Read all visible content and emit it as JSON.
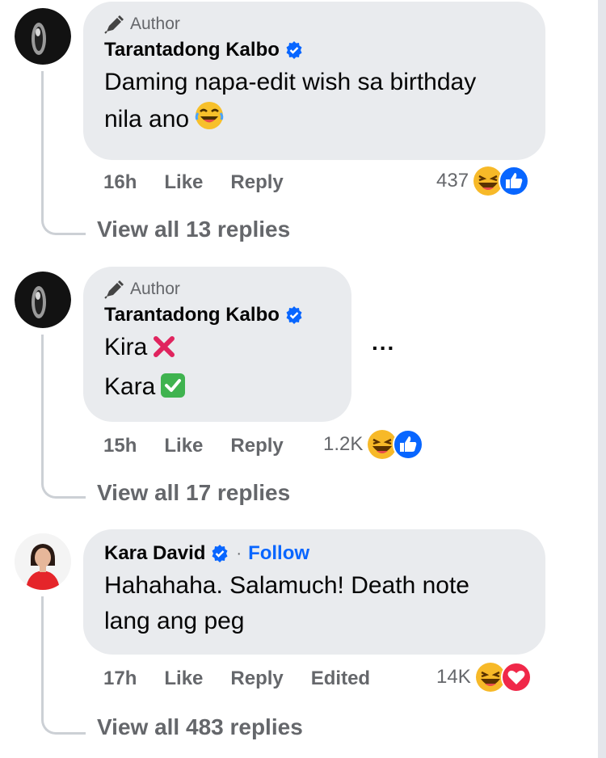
{
  "comments": [
    {
      "author_badge": "Author",
      "author_name": "Tarantadong Kalbo",
      "text_line1": "Daming napa-edit wish sa birthday",
      "text_line2": "nila ano",
      "time": "16h",
      "like_label": "Like",
      "reply_label": "Reply",
      "reaction_count": "437",
      "reaction_icons": [
        "haha-icon",
        "like-icon"
      ],
      "view_replies": "View all 13 replies"
    },
    {
      "author_badge": "Author",
      "author_name": "Tarantadong Kalbo",
      "text_line1": "Kira",
      "text_line2": "Kara",
      "time": "15h",
      "like_label": "Like",
      "reply_label": "Reply",
      "reaction_count": "1.2K",
      "reaction_icons": [
        "haha-icon",
        "like-icon"
      ],
      "more_label": "...",
      "view_replies": "View all 17 replies"
    },
    {
      "author_name": "Kara David",
      "follow_label": "Follow",
      "separator": "·",
      "text_line1": "Hahahaha. Salamuch! Death note",
      "text_line2": "lang ang peg",
      "time": "17h",
      "like_label": "Like",
      "reply_label": "Reply",
      "edited_label": "Edited",
      "reaction_count": "14K",
      "reaction_icons": [
        "haha-icon",
        "love-icon"
      ],
      "view_replies": "View all 483 replies"
    }
  ],
  "colors": {
    "bubble": "#e9ebee",
    "verified": "#0866ff",
    "secondary_text": "#65676b",
    "follow": "#0866ff"
  }
}
